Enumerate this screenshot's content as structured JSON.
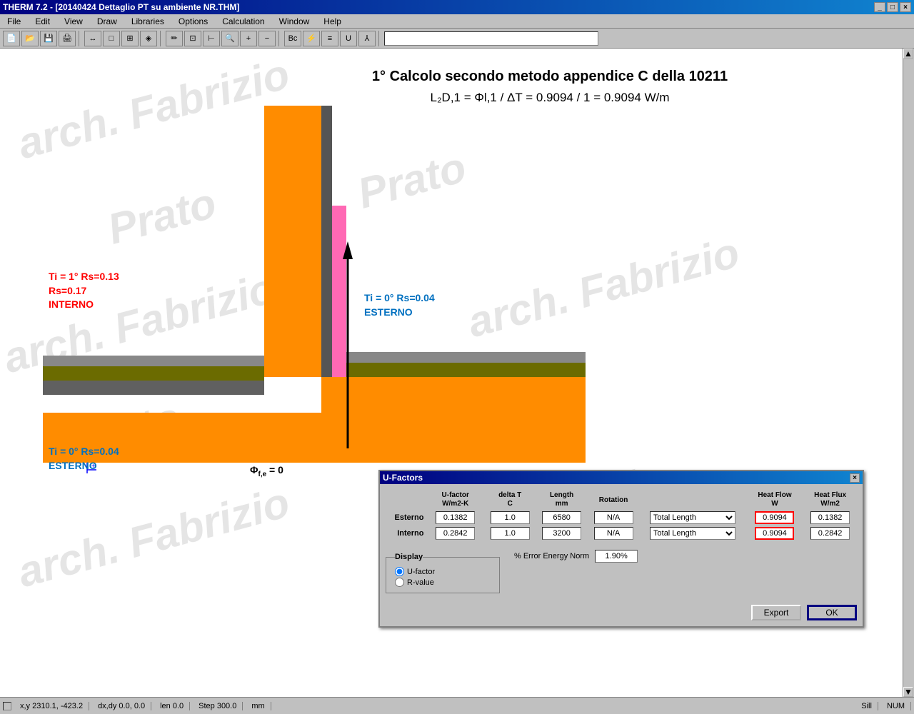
{
  "window": {
    "title": "THERM 7.2 - [20140424 Dettaglio PT su ambiente NR.THM]",
    "title_buttons": [
      "_",
      "□",
      "×"
    ]
  },
  "menubar": {
    "items": [
      "File",
      "Edit",
      "View",
      "Draw",
      "Libraries",
      "Options",
      "Calculation",
      "Window",
      "Help"
    ]
  },
  "canvas": {
    "calc_title": "1° Calcolo secondo metodo appendice C  della 10211",
    "calc_formula_line1": "L",
    "calc_formula": "L₂D,1 = Φl,1 / ΔT = 0.9094 / 1  =  0.9094 W/m",
    "label_interno_temp": "Ti = 1° Rs=0.13",
    "label_interno_rs": "Rs=0.17",
    "label_interno": "INTERNO",
    "label_esterno1_temp": "Ti = 0° Rs=0.04",
    "label_esterno1": "ESTERNO",
    "label_esterno2_temp": "Ti = 0° Rs=0.04",
    "label_esterno2": "ESTERNO",
    "label_phi": "Φf,e = 0"
  },
  "ufactors_dialog": {
    "title": "U-Factors",
    "columns": {
      "ufactor": "U-factor\nW/m2-K",
      "delta_t": "delta T\nC",
      "length": "Length\nmm",
      "rotation": "Rotation",
      "type_dropdown": "Total Length",
      "heat_flow": "Heat Flow\nW",
      "heat_flux": "Heat Flux\nW/m2"
    },
    "rows": [
      {
        "label": "Esterno",
        "ufactor": "0.1382",
        "delta_t": "1.0",
        "length": "6580",
        "rotation": "N/A",
        "type": "Total Length",
        "heat_flow": "0.9094",
        "heat_flux": "0.1382"
      },
      {
        "label": "Interno",
        "ufactor": "0.2842",
        "delta_t": "1.0",
        "length": "3200",
        "rotation": "N/A",
        "type": "Total Length",
        "heat_flow": "0.9094",
        "heat_flux": "0.2842"
      }
    ],
    "display_section": {
      "title": "Display",
      "option1": "U-factor",
      "option2": "R-value",
      "option1_checked": true,
      "option2_checked": false
    },
    "error_label": "% Error Energy Norm",
    "error_value": "1.90%",
    "buttons": {
      "export": "Export",
      "ok": "OK"
    }
  },
  "statusbar": {
    "coords": "x,y  2310.1, -423.2",
    "dxdy": "dx,dy  0.0, 0.0",
    "len": "len  0.0",
    "step": "Step 300.0",
    "unit": "mm",
    "right1": "Sill",
    "right2": "NUM"
  }
}
